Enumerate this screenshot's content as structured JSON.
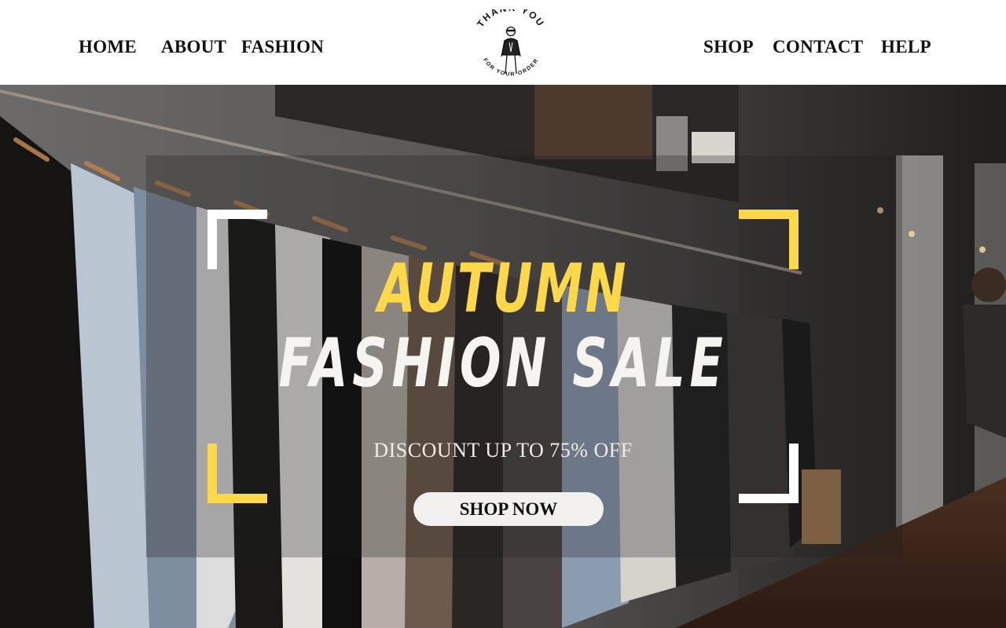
{
  "nav": {
    "left": [
      "HOME",
      "ABOUT",
      "FASHION"
    ],
    "right": [
      "SHOP",
      "CONTACT",
      "HELP"
    ]
  },
  "logo": {
    "text_top": "THANK YOU",
    "text_bottom": "FOR YOUR ORDER"
  },
  "hero": {
    "headline_line1": "AUTUMN",
    "headline_line2": "FASHION SALE",
    "discount_text": "DISCOUNT UP TO 75% OFF",
    "cta_label": "SHOP NOW"
  },
  "colors": {
    "accent_yellow": "#ffd84a",
    "headline_white": "#f6f4f1",
    "nav_text": "#121212",
    "button_bg": "#f2f0ee"
  }
}
